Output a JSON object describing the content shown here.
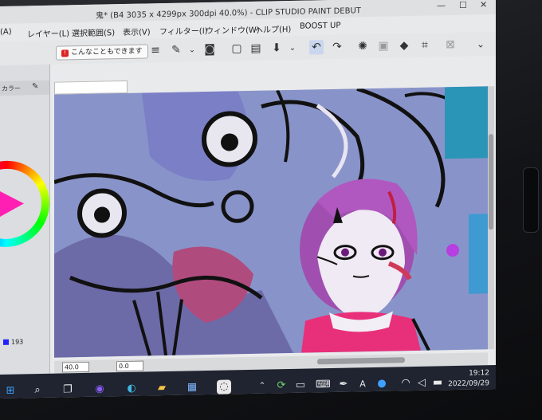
{
  "window": {
    "title": "鬼* (B4 3035 x 4299px 300dpi 40.0%) - CLIP STUDIO PAINT DEBUT",
    "controls": {
      "minimize": "—",
      "maximize": "☐",
      "close": "✕"
    }
  },
  "menu": [
    "(A)",
    "レイヤー(L)",
    "選択範囲(S)",
    "表示(V)",
    "フィルター(I)",
    "ウィンドウ(W)",
    "ヘルプ(H)",
    "BOOST UP"
  ],
  "toolbar": {
    "hint_label": "こんなこともできます",
    "icons": [
      "hamburger-icon",
      "layer-property-icon",
      "chevron-down-icon",
      "companion-mode-icon",
      "new-file-icon",
      "open-folder-icon",
      "save-icon",
      "chevron-down-icon",
      "undo-icon",
      "redo-icon",
      "loading-icon",
      "clear-icon",
      "fill-icon",
      "transform-icon",
      "hide-selection-icon",
      "collapse-icon"
    ]
  },
  "left_panel": {
    "header_label": "カラー",
    "color_value": "193"
  },
  "status": {
    "zoom": "40.0",
    "angle": "0.0"
  },
  "taskbar": {
    "time": "19:12",
    "date": "2022/09/29",
    "ime_label": "A"
  },
  "colors": {
    "canvas_base": "#8894c9",
    "accent_pink": "#ff1fb3",
    "taskbar_bg": "#1f2430",
    "toolbar_active": "#c9d6ee"
  }
}
